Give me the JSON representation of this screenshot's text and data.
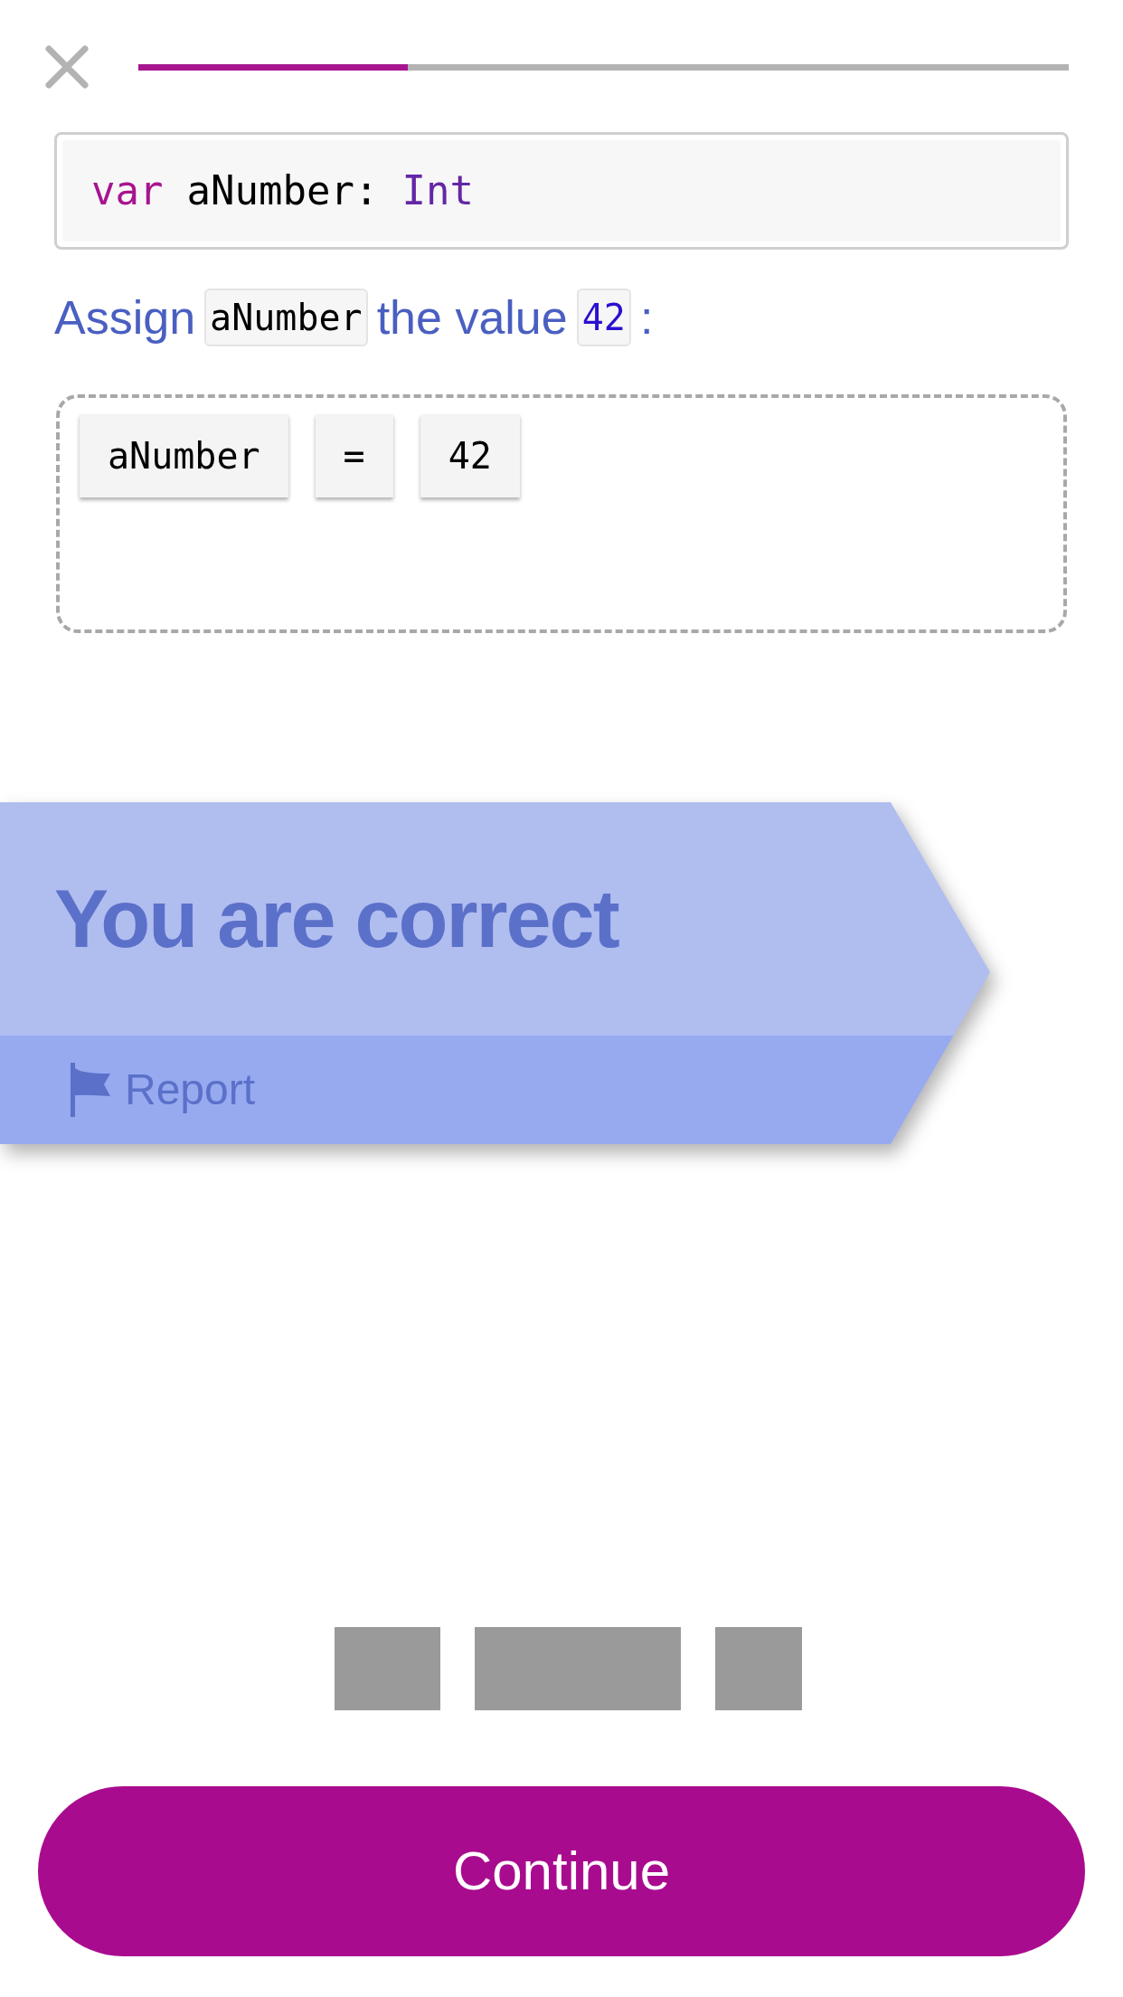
{
  "progress": {
    "level": 0.29
  },
  "code": {
    "tokens": [
      {
        "text": "var",
        "kind": "keyword"
      },
      {
        "text": "aNumber:",
        "kind": "plain"
      },
      {
        "text": "Int",
        "kind": "type"
      }
    ]
  },
  "prompt": [
    {
      "text": "Assign",
      "kind": "text"
    },
    {
      "text": "aNumber",
      "kind": "code"
    },
    {
      "text": "the value",
      "kind": "text"
    },
    {
      "text": "42",
      "kind": "number"
    },
    {
      "text": ":",
      "kind": "punct"
    }
  ],
  "answer": {
    "tokens": [
      {
        "text": "aNumber"
      },
      {
        "text": "="
      },
      {
        "text": "42"
      }
    ]
  },
  "feedback": {
    "title": "You are correct",
    "report": "Report"
  },
  "word_bank": {
    "slots": [
      {
        "kind": "empty"
      },
      {
        "kind": "empty"
      },
      {
        "kind": "empty"
      }
    ]
  },
  "continue_button": "Continue"
}
